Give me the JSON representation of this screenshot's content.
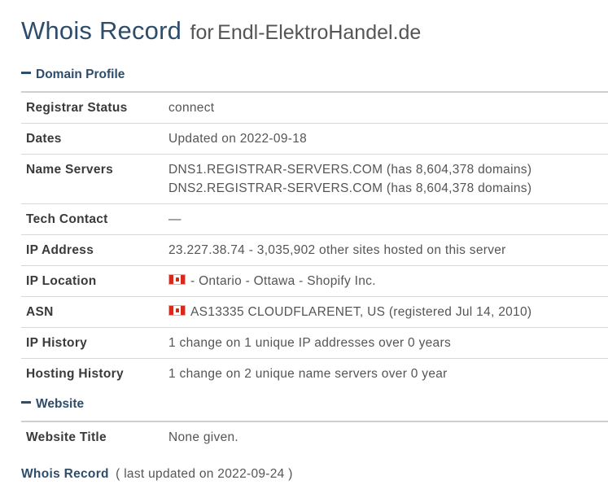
{
  "header": {
    "title": "Whois Record",
    "for": "for",
    "domain": "Endl-ElektroHandel.de"
  },
  "domain_profile": {
    "heading": "Domain Profile",
    "rows": {
      "registrar_status": {
        "label": "Registrar Status",
        "value": "connect"
      },
      "dates": {
        "label": "Dates",
        "value": "Updated on 2022-09-18"
      },
      "name_servers": {
        "label": "Name Servers",
        "ns1": "DNS1.REGISTRAR-SERVERS.COM (has 8,604,378 domains)",
        "ns2": "DNS2.REGISTRAR-SERVERS.COM (has 8,604,378 domains)"
      },
      "tech_contact": {
        "label": "Tech Contact",
        "value": "—"
      },
      "ip_address": {
        "label": "IP Address",
        "value": "23.227.38.74 - 3,035,902 other sites hosted on this server"
      },
      "ip_location": {
        "label": "IP Location",
        "value": "- Ontario - Ottawa - Shopify Inc.",
        "flag_icon": "canada-flag-icon"
      },
      "asn": {
        "label": "ASN",
        "value": "AS13335 CLOUDFLARENET, US (registered Jul 14, 2010)",
        "flag_icon": "canada-flag-icon"
      },
      "ip_history": {
        "label": "IP History",
        "value": "1 change on 1 unique IP addresses over 0 years"
      },
      "hosting_history": {
        "label": "Hosting History",
        "value": "1 change on 2 unique name servers over 0 year"
      }
    }
  },
  "website": {
    "heading": "Website",
    "rows": {
      "website_title": {
        "label": "Website Title",
        "value": "None given."
      }
    }
  },
  "footer": {
    "link": "Whois Record",
    "updated": "( last updated on 2022-09-24 )"
  },
  "colors": {
    "accent": "#2e4d6b",
    "text": "#555555",
    "divider": "#d8d8d8",
    "flag_red": "#d52b1e"
  }
}
